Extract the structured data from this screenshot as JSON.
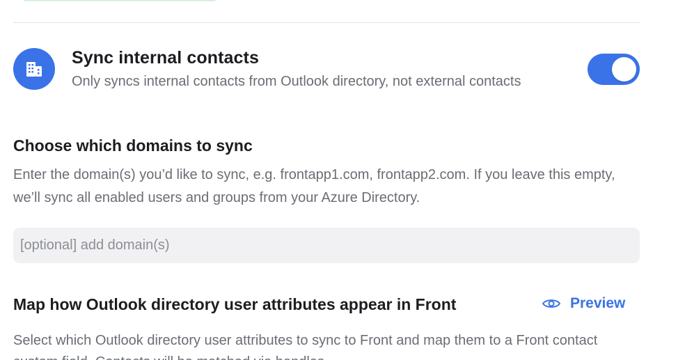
{
  "sync_internal": {
    "title": "Sync internal contacts",
    "description": "Only syncs internal contacts from Outlook directory, not external contacts",
    "icon": "building-icon",
    "enabled": true
  },
  "domains": {
    "title": "Choose which domains to sync",
    "description": "Enter the domain(s) you’d like to sync, e.g. frontapp1.com, frontapp2.com. If you leave this empty, we’ll sync all enabled users and groups from your Azure Directory.",
    "input_placeholder": "[optional] add domain(s)",
    "input_value": ""
  },
  "attributes": {
    "title": "Map how Outlook directory user attributes appear in Front",
    "preview_label": "Preview",
    "preview_icon": "eye-icon",
    "description": "Select which Outlook directory user attributes to sync to Front and map them to a Front contact custom field. Contacts will be matched via handles."
  },
  "colors": {
    "accent": "#3a73e8",
    "muted_text": "#6a6d74",
    "input_bg": "#f1f1f3"
  }
}
